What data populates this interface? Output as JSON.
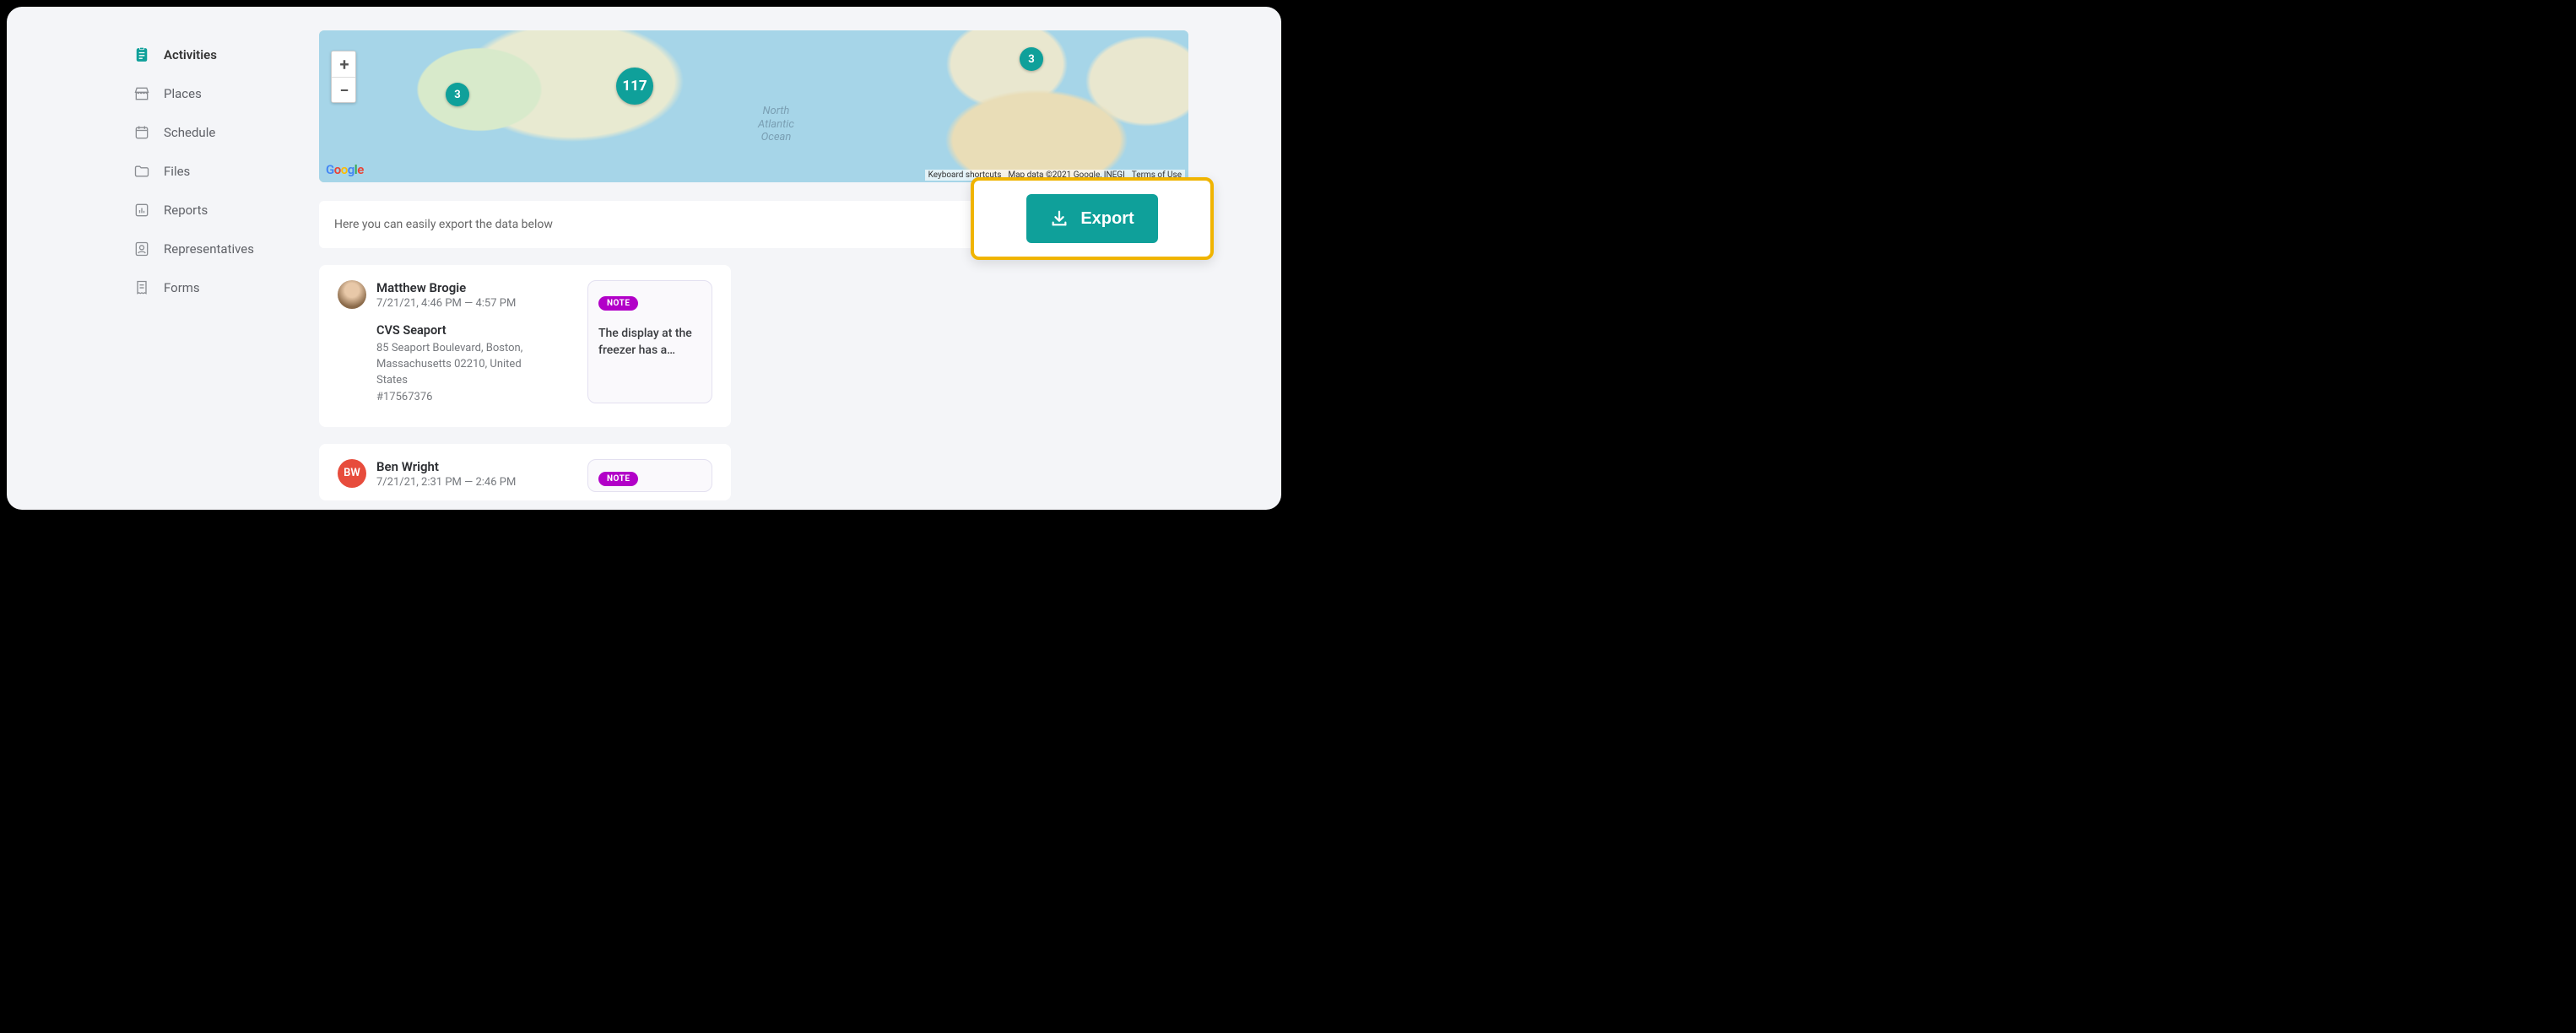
{
  "sidebar": {
    "items": [
      {
        "id": "activities",
        "label": "Activities",
        "icon": "clipboard-icon",
        "active": true
      },
      {
        "id": "places",
        "label": "Places",
        "icon": "store-icon",
        "active": false
      },
      {
        "id": "schedule",
        "label": "Schedule",
        "icon": "calendar-icon",
        "active": false
      },
      {
        "id": "files",
        "label": "Files",
        "icon": "folder-icon",
        "active": false
      },
      {
        "id": "reports",
        "label": "Reports",
        "icon": "bar-chart-icon",
        "active": false
      },
      {
        "id": "representatives",
        "label": "Representatives",
        "icon": "user-badge-icon",
        "active": false
      },
      {
        "id": "forms",
        "label": "Forms",
        "icon": "receipt-icon",
        "active": false
      }
    ]
  },
  "map": {
    "clusters": [
      3,
      117,
      3
    ],
    "ocean_label": "North\nAtlantic\nOcean",
    "attribution": {
      "shortcuts": "Keyboard shortcuts",
      "data": "Map data ©2021 Google, INEGI",
      "terms": "Terms of Use"
    },
    "zoom_in": "+",
    "zoom_out": "−",
    "provider": "Google"
  },
  "export_bar": {
    "hint": "Here you can easily export the data below",
    "button_label": "Export"
  },
  "activities": [
    {
      "avatar_kind": "photo",
      "initials": "",
      "name": "Matthew Brogie",
      "time": "7/21/21, 4:46 PM — 4:57 PM",
      "place_name": "CVS Seaport",
      "place_addr": "85 Seaport Boulevard, Boston, Massachusetts 02210, United States",
      "place_id": "#17567376",
      "note_badge": "NOTE",
      "note_text": "The display at the freezer has a…"
    },
    {
      "avatar_kind": "red",
      "initials": "BW",
      "name": "Ben Wright",
      "time": "7/21/21, 2:31 PM — 2:46 PM",
      "place_name": "",
      "place_addr": "",
      "place_id": "",
      "note_badge": "NOTE",
      "note_text": ""
    }
  ]
}
